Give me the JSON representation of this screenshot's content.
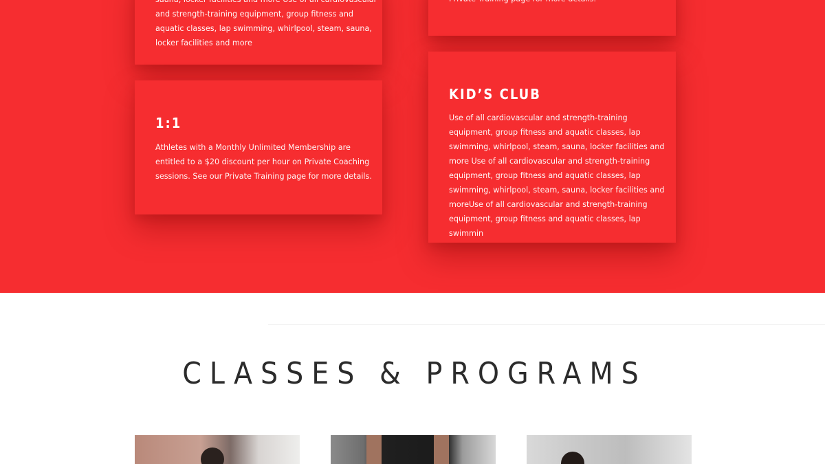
{
  "cards": {
    "top_left": {
      "text": "sauna, locker facilities and more Use of all cardiovascular and strength-training equipment, group fitness and aquatic classes, lap swimming, whirlpool, steam, sauna, locker facilities and more"
    },
    "top_right": {
      "text": "Private Training page for more details."
    },
    "one_on_one": {
      "title": "1:1",
      "text": "Athletes with a Monthly Unlimited Membership are entitled to a $20 discount per hour on Private Coaching sessions. See our Private Training page for more details."
    },
    "kids_club": {
      "title": "KID’S CLUB",
      "text": "Use of all cardiovascular and strength-training equipment, group fitness and aquatic classes, lap swimming, whirlpool, steam, sauna, locker facilities and more Use of all cardiovascular and strength-training equipment, group fitness and aquatic classes, lap swimming, whirlpool, steam, sauna, locker facilities and moreUse of all cardiovascular and strength-training equipment, group fitness and aquatic classes, lap swimmin"
    }
  },
  "programs": {
    "heading": "CLASSES & PROGRAMS"
  },
  "colors": {
    "accent_red": "#f62d30",
    "heading_text": "#2b2b2b",
    "background": "#ffffff"
  }
}
